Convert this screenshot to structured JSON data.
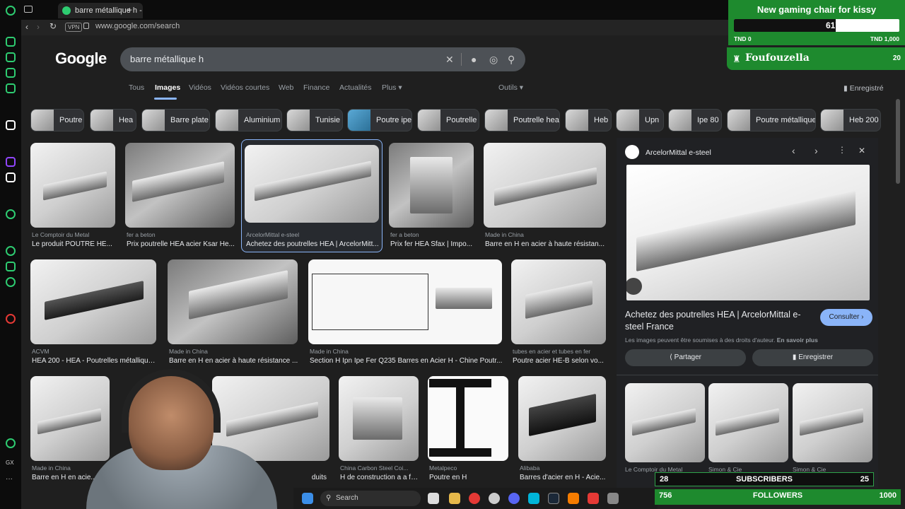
{
  "browser": {
    "tab_title": "barre métallique h - Reche",
    "vpn_label": "VPN",
    "address": "www.google.com/search"
  },
  "google": {
    "logo": "Google",
    "query": "barre métallique h",
    "nav": [
      "Tous",
      "Images",
      "Vidéos",
      "Vidéos courtes",
      "Web",
      "Finance",
      "Actualités",
      "Plus"
    ],
    "tools": "Outils",
    "saved": "Enregistré"
  },
  "chips": [
    "Poutre",
    "Hea",
    "Barre plate",
    "Aluminium",
    "Tunisie",
    "Poutre ipe",
    "Poutrelle",
    "Poutrelle hea",
    "Heb",
    "Upn",
    "Ipe 80",
    "Poutre métallique",
    "Heb 200"
  ],
  "results": [
    {
      "source": "Le Comptoir du Metal",
      "caption": "Le produit POUTRE HE..."
    },
    {
      "source": "fer a beton",
      "caption": "Prix poutrelle HEA acier Ksar He..."
    },
    {
      "source": "ArcelorMittal e-steel",
      "caption": "Achetez des poutrelles HEA | ArcelorMitt..."
    },
    {
      "source": "fer a beton",
      "caption": "Prix fer HEA Sfax | Impo..."
    },
    {
      "source": "Made in China",
      "caption": "Barre en H en acier à haute résistan..."
    },
    {
      "source": "ACVM",
      "caption": "HEA 200 - HEA - Poutrelles métallique..."
    },
    {
      "source": "Made in China",
      "caption": "Barre en H en acier à haute résistance ..."
    },
    {
      "source": "Made in China",
      "caption": "Section H Ipn Ipe Fer Q235 Barres en Acier H - Chine Poutr..."
    },
    {
      "source": "tubes en acier et tubes en fer",
      "caption": "Poutre acier HE-B selon vo..."
    },
    {
      "source": "Made in China",
      "caption": "Barre en H en acie..."
    },
    {
      "source": "",
      "caption": "duits"
    },
    {
      "source": "China Carbon Steel Coi...",
      "caption": "H de construction a a for..."
    },
    {
      "source": "Metalpeco",
      "caption": "Poutre en H"
    },
    {
      "source": "Alibaba",
      "caption": "Barres d'acier en H - Acie..."
    }
  ],
  "panel": {
    "site": "ArcelorMittal e-steel",
    "title": "Achetez des poutrelles HEA | ArcelorMittal e-steel France",
    "consult": "Consulter",
    "copyright": "Les images peuvent être soumises à des droits d'auteur.",
    "learn_more": "En savoir plus",
    "share": "Partager",
    "save": "Enregistrer",
    "related": [
      {
        "source": "Le Comptoir du Metal"
      },
      {
        "source": "Simon & Cie"
      },
      {
        "source": "Simon & Cie"
      }
    ]
  },
  "overlay": {
    "goal_title": "New gaming chair for kissy",
    "goal_value": "617",
    "goal_progress": 0.617,
    "goal_min": "TND 0",
    "goal_max": "TND 1,000",
    "leader_name": "Foufouzella",
    "leader_count": "20",
    "subs_left": "28",
    "subs_label": "SUBSCRIBERS",
    "subs_right": "25",
    "followers_left": "756",
    "followers_label": "FOLLOWERS",
    "followers_right": "1000"
  },
  "taskbar": {
    "search": "Search"
  },
  "colors": {
    "accent": "#8ab4f8",
    "overlay_green": "#1e8a2e",
    "browser_green": "#2ecc71"
  }
}
